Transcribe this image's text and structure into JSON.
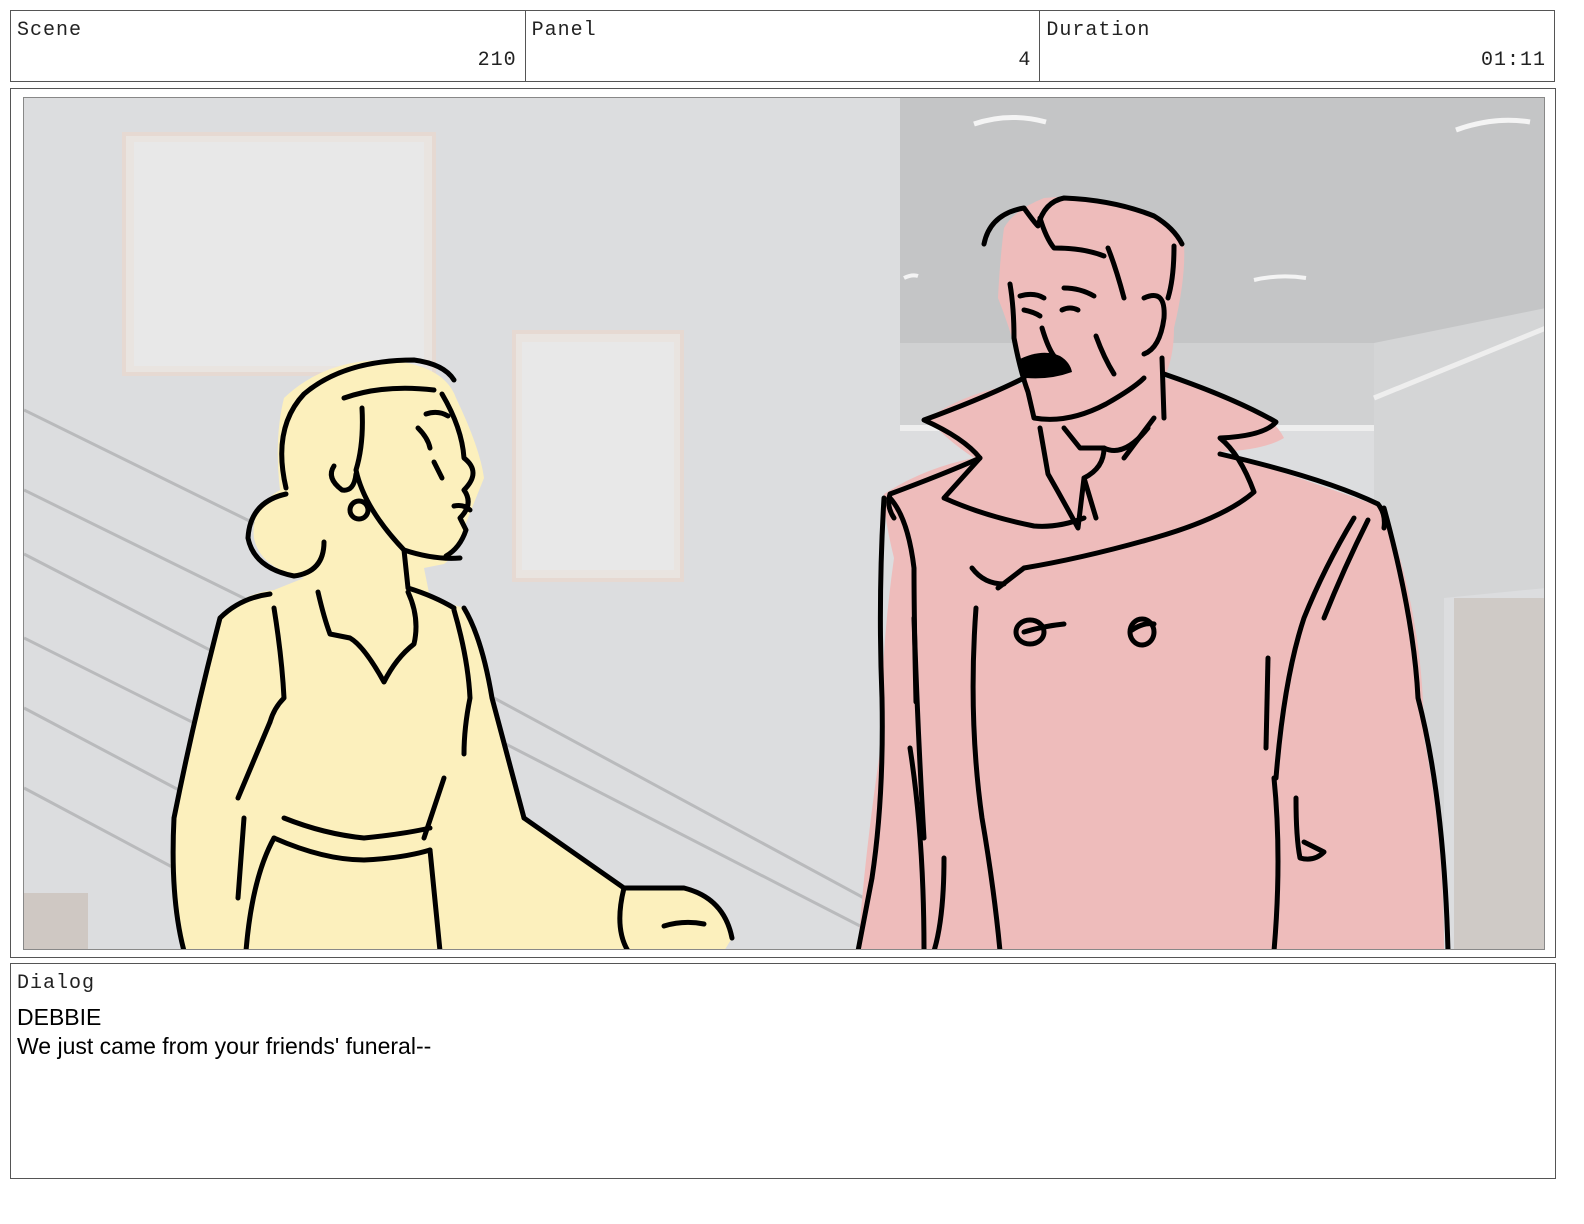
{
  "header": {
    "scene_label": "Scene",
    "scene_value": "210",
    "panel_label": "Panel",
    "panel_value": "4",
    "duration_label": "Duration",
    "duration_value": "01:11"
  },
  "dialog": {
    "label": "Dialog",
    "speaker": "DEBBIE",
    "line": "We just came from your friends' funeral--"
  },
  "colors": {
    "wall": "#dcdddf",
    "ceiling": "#c4c5c6",
    "woman_fill": "#fcf0bd",
    "man_fill": "#eebcbb",
    "ink": "#000000"
  }
}
